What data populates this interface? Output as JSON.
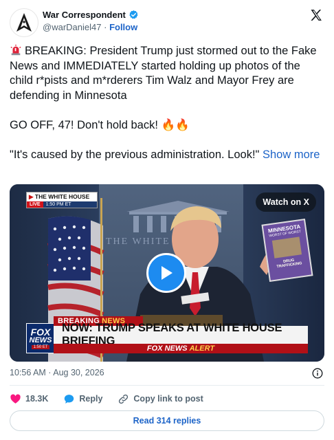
{
  "author": {
    "name": "War Correspondent",
    "handle": "@warDaniel47",
    "separator": "·",
    "follow_label": "Follow",
    "avatar_icon": "arrowhead-logo-icon",
    "verified_icon": "verified-badge-icon"
  },
  "platform_icon": "x-logo-icon",
  "tweet": {
    "line1": "BREAKING: President Trump just stormed out to the Fake News and IMMEDIATELY started holding up photos of the child r*pists and m*rderers Tim Walz and Mayor Frey are defending in Minnesota",
    "line2": "GO OFF, 47! Don't hold back! 🔥🔥",
    "line3": "\"It's caused by the previous administration. Look!\"",
    "show_more": "Show more",
    "siren_icon": "rotating-light-icon"
  },
  "media": {
    "wh_badge_title": "THE WHITE HOUSE",
    "wh_live": "LIVE",
    "wh_time": "1:50 PM ET",
    "watch_label": "Watch on X",
    "house_text": "THE WHITE HOUSE",
    "breaking_label": "BREAKING",
    "breaking_news": "NEWS",
    "headline": "NOW: TRUMP SPEAKS AT WHITE HOUSE BRIEFING",
    "alert_brand": "FOX NEWS",
    "alert_word": "ALERT",
    "fox_logo_l1": "FOX",
    "fox_logo_l2": "NEWS",
    "fox_logo_time": "1:50 ET",
    "sign_title": "MINNESOTA",
    "sign_sub": "WORST OF WORST",
    "sign_crime": "DRUG TRAFFICKING"
  },
  "meta": {
    "timestamp": "10:56 AM · Aug 30, 2026"
  },
  "actions": {
    "likes": "18.3K",
    "reply_label": "Reply",
    "copy_label": "Copy link to post"
  },
  "read_replies": "Read 314 replies",
  "colors": {
    "link": "#1d64c8",
    "like": "#f91880",
    "play": "#1d8bf0",
    "fox_red": "#b11017"
  }
}
